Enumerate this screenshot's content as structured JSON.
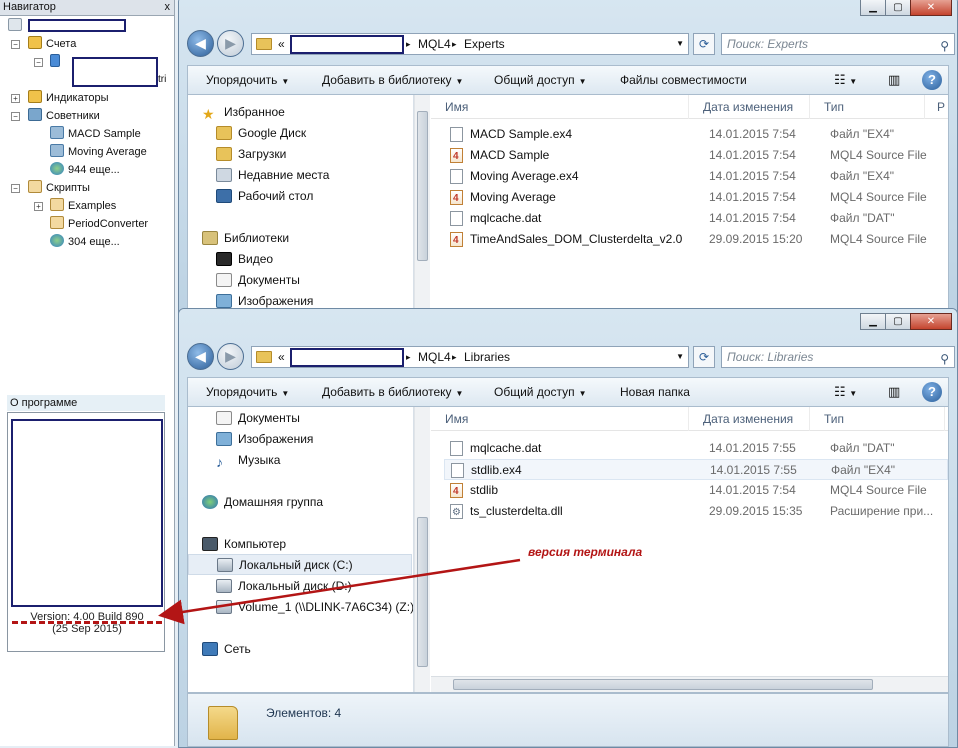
{
  "navigator": {
    "title": "Навигатор",
    "close": "x",
    "tree": [
      {
        "label": "Счета"
      },
      {
        "label": "tri"
      },
      {
        "label": "Индикаторы"
      },
      {
        "label": "Советники"
      },
      {
        "label": "MACD Sample"
      },
      {
        "label": "Moving Average"
      },
      {
        "label": "944 еще..."
      },
      {
        "label": "Скрипты"
      },
      {
        "label": "Examples"
      },
      {
        "label": "PeriodConverter"
      },
      {
        "label": "304 еще..."
      }
    ]
  },
  "about": {
    "label": "О программе",
    "version_line1": "Version: 4.00  Build 890",
    "version_line2": "(25 Sep 2015)"
  },
  "annotation": "версия терминала",
  "window_top": {
    "path_prefix": "«",
    "path": [
      "MQL4",
      "Experts"
    ],
    "search_placeholder": "Поиск: Experts",
    "toolbar": [
      "Упорядочить",
      "Добавить в библиотеку",
      "Общий доступ",
      "Файлы совместимости"
    ],
    "pane": [
      {
        "label": "Избранное",
        "icon": "star-icon"
      },
      {
        "label": "Google Диск",
        "icon": "folder-icon"
      },
      {
        "label": "Загрузки",
        "icon": "download-folder-icon"
      },
      {
        "label": "Недавние места",
        "icon": "recent-places-icon"
      },
      {
        "label": "Рабочий стол",
        "icon": "desktop-icon"
      },
      {
        "label": "Библиотеки",
        "icon": "libraries-icon"
      },
      {
        "label": "Видео",
        "icon": "video-icon"
      },
      {
        "label": "Документы",
        "icon": "documents-icon"
      },
      {
        "label": "Изображения",
        "icon": "images-icon"
      }
    ],
    "columns": [
      "Имя",
      "Дата изменения",
      "Тип",
      "Р"
    ],
    "files": [
      {
        "name": "MACD Sample.ex4",
        "date": "14.01.2015 7:54",
        "type": "Файл \"EX4\"",
        "icon": "file-icon"
      },
      {
        "name": "MACD Sample",
        "date": "14.01.2015 7:54",
        "type": "MQL4 Source File",
        "icon": "mql4-file-icon"
      },
      {
        "name": "Moving Average.ex4",
        "date": "14.01.2015 7:54",
        "type": "Файл \"EX4\"",
        "icon": "file-icon"
      },
      {
        "name": "Moving Average",
        "date": "14.01.2015 7:54",
        "type": "MQL4 Source File",
        "icon": "mql4-file-icon"
      },
      {
        "name": "mqlcache.dat",
        "date": "14.01.2015 7:54",
        "type": "Файл \"DAT\"",
        "icon": "file-icon"
      },
      {
        "name": "TimeAndSales_DOM_Clusterdelta_v2.0",
        "date": "29.09.2015 15:20",
        "type": "MQL4 Source File",
        "icon": "mql4-file-icon"
      }
    ]
  },
  "window_bottom": {
    "path_prefix": "«",
    "path": [
      "MQL4",
      "Libraries"
    ],
    "search_placeholder": "Поиск: Libraries",
    "toolbar": [
      "Упорядочить",
      "Добавить в библиотеку",
      "Общий доступ",
      "Новая папка"
    ],
    "pane": [
      {
        "label": "Документы",
        "icon": "documents-icon"
      },
      {
        "label": "Изображения",
        "icon": "images-icon"
      },
      {
        "label": "Музыка",
        "icon": "music-icon"
      },
      {
        "label": "Домашняя группа",
        "icon": "homegroup-icon"
      },
      {
        "label": "Компьютер",
        "icon": "computer-icon"
      },
      {
        "label": "Локальный диск (C:)",
        "icon": "drive-icon"
      },
      {
        "label": "Локальный диск (D:)",
        "icon": "drive-icon"
      },
      {
        "label": "Volume_1 (\\\\DLINK-7A6C34) (Z:)",
        "icon": "network-drive-icon"
      },
      {
        "label": "Сеть",
        "icon": "network-icon"
      }
    ],
    "columns": [
      "Имя",
      "Дата изменения",
      "Тип"
    ],
    "files": [
      {
        "name": "mqlcache.dat",
        "date": "14.01.2015 7:55",
        "type": "Файл \"DAT\"",
        "icon": "file-icon"
      },
      {
        "name": "stdlib.ex4",
        "date": "14.01.2015 7:55",
        "type": "Файл \"EX4\"",
        "icon": "file-icon"
      },
      {
        "name": "stdlib",
        "date": "14.01.2015 7:54",
        "type": "MQL4 Source File",
        "icon": "mql4-file-icon"
      },
      {
        "name": "ts_clusterdelta.dll",
        "date": "29.09.2015 15:35",
        "type": "Расширение при...",
        "icon": "dll-file-icon"
      }
    ],
    "status": "Элементов: 4"
  },
  "colors": {
    "annotation": "#b31515",
    "redaction_border": "#1b1f6e",
    "selection": "#e7eef6"
  }
}
